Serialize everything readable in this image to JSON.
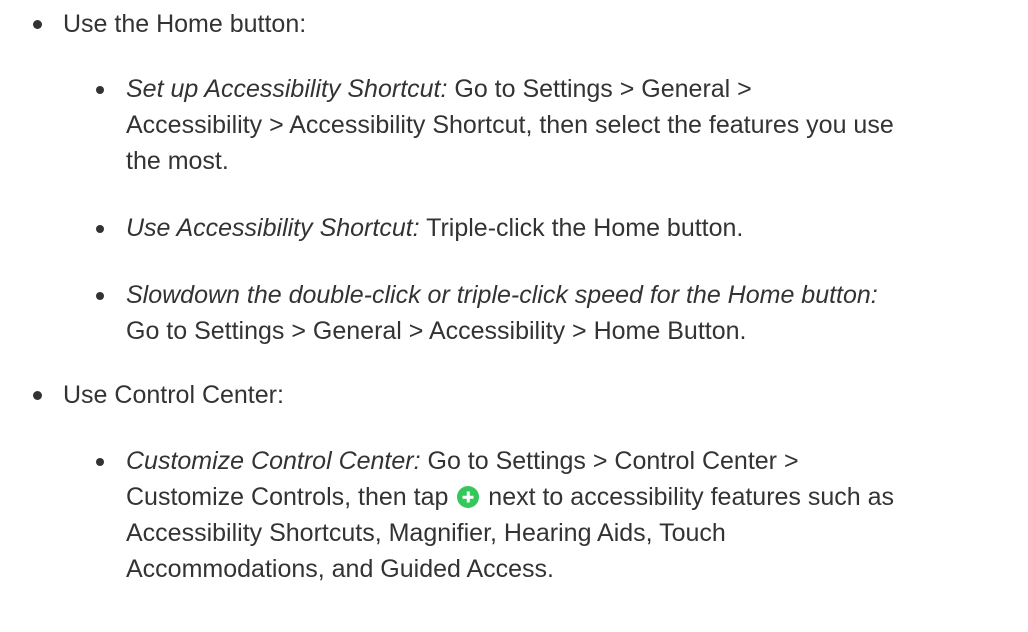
{
  "list": {
    "home": {
      "label": "Use the Home button:",
      "items": [
        {
          "label": "Set up Accessibility Shortcut:",
          "lines": [
            " Go to Settings > General >",
            "Accessibility > Accessibility Shortcut, then select the features you use",
            "the most."
          ]
        },
        {
          "label": "Use Accessibility Shortcut:",
          "lines": [
            " Triple-click the Home button."
          ]
        },
        {
          "label": "Slowdown the double-click or triple-click speed for the Home button:",
          "lines": [
            "",
            "Go to Settings > General > Accessibility > Home Button."
          ]
        }
      ]
    },
    "control_center": {
      "label": "Use Control Center:",
      "items": [
        {
          "label": "Customize Control Center:",
          "lines": [
            " Go to Settings > Control Center >",
            "Customize Controls, then tap",
            " next to accessibility features such as",
            "Accessibility Shortcuts, Magnifier, Hearing Aids, Touch",
            "Accommodations, and Guided Access."
          ],
          "icon": "add-circle-icon",
          "icon_color": "#34c759"
        }
      ]
    }
  }
}
